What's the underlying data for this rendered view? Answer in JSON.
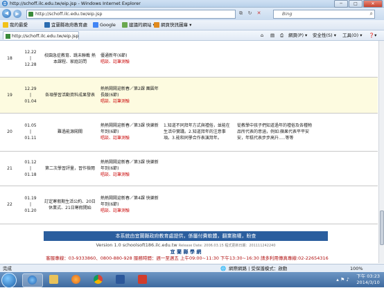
{
  "window": {
    "title": "http://schoff.ilc.edu.tw/eip.jsp - Windows Internet Explorer",
    "minimize": "─",
    "maximize": "□",
    "close": "✕"
  },
  "address": {
    "url": "http://schoff.ilc.edu.tw/eip.jsp",
    "search_placeholder": "Bing"
  },
  "favorites": {
    "label": "我的最愛",
    "items": [
      "宜蘭縣政府教育處",
      "Google",
      "建議的網站 ▾",
      "網頁快訊圖庫 ▾"
    ]
  },
  "tab": {
    "label": "http://schoff.ilc.edu.tw/eip.jsp"
  },
  "commands": {
    "page": "網頁(P) ▾",
    "safety": "安全性(S) ▾",
    "tools": "工具(O) ▾",
    "help": "❓▾"
  },
  "rows": [
    {
      "week": "18",
      "date_top": "12.22",
      "date_sep": "|",
      "date_bottom": "12.28",
      "topic": "校園急症教育、跳未聯載 熱本課程、家庭訪問",
      "unit": "優通新年(6節)",
      "unit_red": "唱談、話筆測驗",
      "aim": "",
      "activity": "",
      "highlight": false
    },
    {
      "week": "19",
      "date_top": "12.29",
      "date_sep": "|",
      "date_bottom": "01.04",
      "topic": "各項學習活動資料成果發表",
      "unit": "熱熱鬧鬧迎新春／第2課 團圓年長飯(6節)",
      "unit_red": "唱談、話筆測驗",
      "aim": "",
      "activity": "",
      "highlight": true
    },
    {
      "week": "20",
      "date_top": "01.05",
      "date_sep": "|",
      "date_bottom": "01.11",
      "topic": "難過能源闖關",
      "unit": "熱熱鬧鬧迎新春／第3課 快樂新年到(6節)",
      "unit_red": "唱談、話筆測驗",
      "aim": "1.知道不同拜年方式與禮俗，並能在生活中實踐。2.知道拜年的注意事項。3.能和同學合作表演拜年。",
      "activity": "從教學中孩子們知道過年的禮俗及各種物品所代表的意涵，例如:蘋果代表平平安安，年糕代表步步高升.....等等",
      "highlight": false
    },
    {
      "week": "21",
      "date_top": "01.12",
      "date_sep": "|",
      "date_bottom": "01.18",
      "topic": "第二次學習評量，習作檢閱",
      "unit": "熱熱鬧鬧迎新春／第3課 快樂新年到(6節)",
      "unit_red": "唱談、話筆測驗",
      "aim": "",
      "activity": "",
      "highlight": false
    },
    {
      "week": "22",
      "date_top": "01.19",
      "date_sep": "|",
      "date_bottom": "01.20",
      "topic": "訂定寒假期生活公約、20日休業式、21日寒假開始",
      "unit": "熱熱鬧鬧迎新春／第4課 快樂新年到(6節)",
      "unit_red": "唱談、話筆測驗",
      "aim": "",
      "activity": "",
      "highlight": false
    }
  ],
  "footer": {
    "band": "本系統由宜蘭縣政府教育處提供，係屬付費軟體，翻業務權，盼查",
    "version": "Version 1.0 schoolsoft186.ilc.edu.tw",
    "release": "Release Date: 2006.03.15  程式更新日期：201111242240",
    "brand": "宜 蘭 縣 學 網",
    "service": "客服專線：03-9333860、0800-880-928 服務時間：週一至週五 上午09:00~11:30 下午13:30~16:30 請多利用傳真專線:02-22654316"
  },
  "statusbar": {
    "left": "完成",
    "zone": "網際網路 | 受保護模式：啟動",
    "zoom": "100%"
  },
  "taskbar": {
    "time": "下午 03:23",
    "date": "2014/3/10"
  },
  "colors": {
    "band": "#2b5e9e",
    "red_text": "#cc1111",
    "highlight_row": "#fdfbe0"
  }
}
